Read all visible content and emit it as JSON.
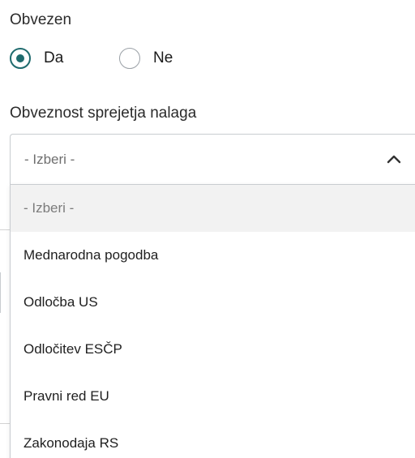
{
  "form": {
    "obvezen": {
      "label": "Obvezen",
      "options": [
        {
          "label": "Da",
          "checked": true
        },
        {
          "label": "Ne",
          "checked": false
        }
      ]
    },
    "obveznost": {
      "label": "Obveznost sprejetja nalaga",
      "selected_value": "- Izberi -",
      "expanded": true,
      "options": [
        "- Izberi -",
        "Mednarodna pogodba",
        "Odločba US",
        "Odločitev ESČP",
        "Pravni red EU",
        "Zakonodaja RS"
      ]
    }
  },
  "colors": {
    "radio_accent": "#1f6b6e",
    "placeholder_row_bg": "#f2f2f2",
    "border": "#c8ccd0"
  },
  "icons": {
    "select_toggle": "chevron-up-icon"
  }
}
